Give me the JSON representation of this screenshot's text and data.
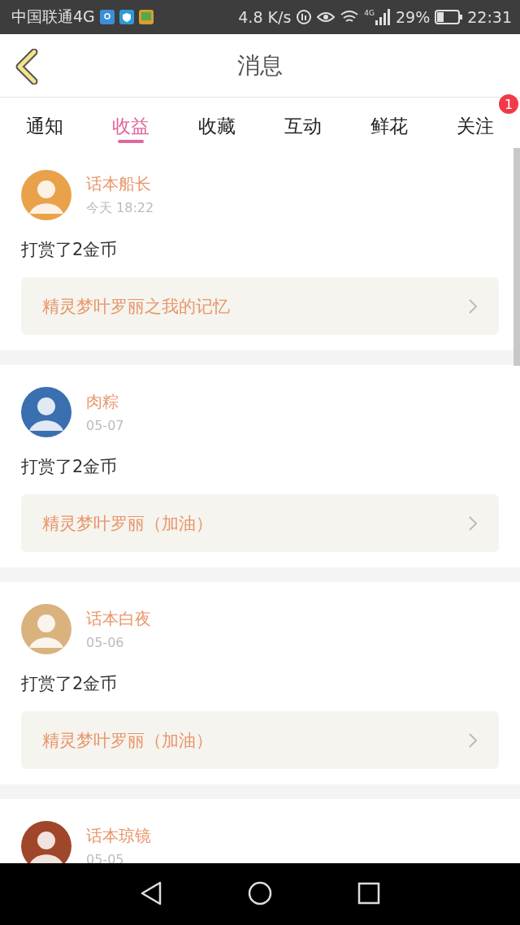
{
  "status_bar": {
    "carrier": "中国联通4G",
    "speed": "4.8 K/s",
    "network": "4G",
    "battery": "29%",
    "time": "22:31"
  },
  "header": {
    "title": "消息"
  },
  "tabs": [
    {
      "label": "通知",
      "selected": false
    },
    {
      "label": "收益",
      "selected": true
    },
    {
      "label": "收藏",
      "selected": false
    },
    {
      "label": "互动",
      "selected": false
    },
    {
      "label": "鲜花",
      "selected": false
    },
    {
      "label": "关注",
      "selected": false,
      "badge": "1"
    }
  ],
  "messages": [
    {
      "name": "话本船长",
      "time": "今天 18:22",
      "text": "打赏了2金币",
      "link": "精灵梦叶罗丽之我的记忆",
      "color": "#e9a24a"
    },
    {
      "name": "肉粽",
      "time": "05-07",
      "text": "打赏了2金币",
      "link": "精灵梦叶罗丽（加油）",
      "color": "#3a6fb0"
    },
    {
      "name": "话本白夜",
      "time": "05-06",
      "text": "打赏了2金币",
      "link": "精灵梦叶罗丽（加油）",
      "color": "#d9b27e"
    },
    {
      "name": "话本琼镜",
      "time": "05-05",
      "color": "#a0462a"
    }
  ]
}
